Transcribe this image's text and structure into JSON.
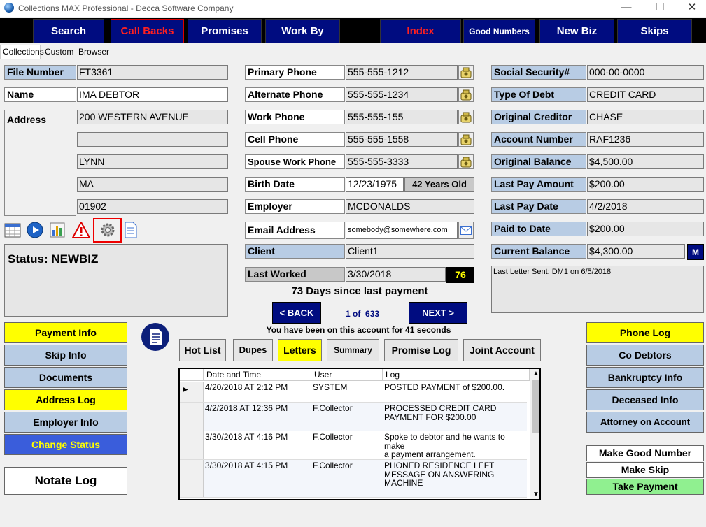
{
  "window": {
    "title": "Collections MAX Professional - Decca Software Company",
    "minimize": "—",
    "maximize": "☐",
    "close": "✕"
  },
  "nav": {
    "search": "Search",
    "call_backs": "Call Backs",
    "promises": "Promises",
    "work_by": "Work By",
    "index": "Index",
    "good_numbers": "Good Numbers",
    "new_biz": "New Biz",
    "skips": "Skips"
  },
  "tabs": {
    "collections": "Collections",
    "custom": "Custom",
    "browser": "Browser"
  },
  "left": {
    "file_number_label": "File Number",
    "file_number": "FT3361",
    "name_label": "Name",
    "name": "IMA DEBTOR",
    "address_label": "Address",
    "address1": "200 WESTERN AVENUE",
    "address2": "",
    "city": "LYNN",
    "state": "MA",
    "zip": "01902",
    "status": "Status: NEWBIZ"
  },
  "middle": {
    "primary_phone_label": "Primary Phone",
    "primary_phone": "555-555-1212",
    "alternate_phone_label": "Alternate Phone",
    "alternate_phone": "555-555-1234",
    "work_phone_label": "Work Phone",
    "work_phone": "555-555-155",
    "cell_phone_label": "Cell Phone",
    "cell_phone": "555-555-1558",
    "spouse_work_phone_label": "Spouse Work Phone",
    "spouse_work_phone": "555-555-3333",
    "birth_date_label": "Birth Date",
    "birth_date": "12/23/1975",
    "age": "42 Years Old",
    "employer_label": "Employer",
    "employer": "MCDONALDS",
    "email_label": "Email Address",
    "email": "somebody@somewhere.com",
    "client_label": "Client",
    "client": "Client1",
    "last_worked_label": "Last Worked",
    "last_worked": "3/30/2018",
    "last_worked_count": "76",
    "days_since_payment": "73 Days since last payment",
    "back": "< BACK",
    "next": "NEXT >",
    "record_pos": "1 of",
    "record_total": "633",
    "time_on_account": "You have been on this account for 41 seconds"
  },
  "right": {
    "ssn_label": "Social Security#",
    "ssn": "000-00-0000",
    "debt_type_label": "Type Of Debt",
    "debt_type": "CREDIT CARD",
    "orig_creditor_label": "Original Creditor",
    "orig_creditor": "CHASE",
    "account_number_label": "Account Number",
    "account_number": "RAF1236",
    "orig_balance_label": "Original Balance",
    "orig_balance": "$4,500.00",
    "last_pay_amount_label": "Last Pay Amount",
    "last_pay_amount": "$200.00",
    "last_pay_date_label": "Last Pay Date",
    "last_pay_date": "4/2/2018",
    "paid_to_date_label": "Paid to Date",
    "paid_to_date": "$200.00",
    "current_balance_label": "Current Balance",
    "current_balance": "$4,300.00",
    "m_button": "M",
    "last_letter": "Last Letter Sent: DM1 on 6/5/2018"
  },
  "left_buttons": [
    "Payment Info",
    "Skip Info",
    "Documents",
    "Address Log",
    "Employer Info",
    "Change Status"
  ],
  "notate_log": "Notate Log",
  "right_buttons": [
    "Phone Log",
    "Co Debtors",
    "Bankruptcy Info",
    "Deceased Info",
    "Attorney on Account"
  ],
  "right_actions": [
    "Make Good Number",
    "Make Skip",
    "Take Payment"
  ],
  "log_tabs": [
    "Hot List",
    "Dupes",
    "Letters",
    "Summary",
    "Promise Log",
    "Joint Account"
  ],
  "log": {
    "headers": [
      "Date and Time",
      "User",
      "Log"
    ],
    "rows": [
      {
        "date": "4/20/2018 AT 2:12 PM",
        "user": "SYSTEM",
        "log": "POSTED PAYMENT of $200.00."
      },
      {
        "date": "4/2/2018 AT 12:36 PM",
        "user": "F.Collector",
        "log": "PROCESSED CREDIT CARD\nPAYMENT FOR $200.00"
      },
      {
        "date": "3/30/2018 AT 4:16 PM",
        "user": "F.Collector",
        "log": "Spoke to debtor and he wants to make\na payment arrangement."
      },
      {
        "date": "3/30/2018 AT 4:15 PM",
        "user": "F.Collector",
        "log": "PHONED RESIDENCE LEFT\nMESSAGE ON ANSWERING\nMACHINE"
      }
    ]
  },
  "colors": {
    "nav_bg": "#000c80",
    "label_bg": "#b8cce4",
    "yellow": "#ffff00",
    "change_status": "#3a5ddb",
    "take_payment": "#90f090"
  }
}
